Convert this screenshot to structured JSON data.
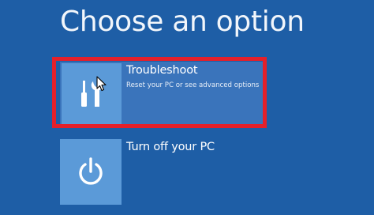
{
  "header": {
    "title": "Choose an option"
  },
  "options": [
    {
      "label": "Troubleshoot",
      "description": "Reset your PC or see advanced options",
      "icon": "wrench-screwdriver-icon",
      "selected": true
    },
    {
      "label": "Turn off your PC",
      "description": "",
      "icon": "power-icon",
      "selected": false
    }
  ],
  "colors": {
    "background": "#1e5ea6",
    "selected_option": "#3a74bb",
    "tile": "#5b9ad8",
    "highlight_frame": "#e5202a",
    "text": "#ffffff"
  }
}
